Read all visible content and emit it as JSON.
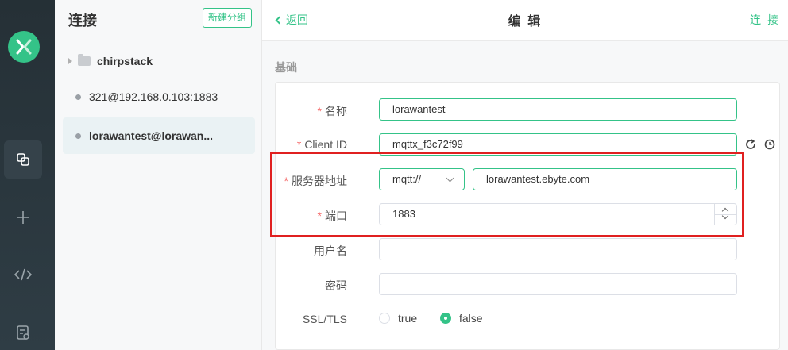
{
  "sidebar_rail": {
    "items": [
      {
        "icon": "connections-icon",
        "active": true
      },
      {
        "icon": "plus-icon",
        "active": false
      },
      {
        "icon": "code-icon",
        "active": false
      },
      {
        "icon": "log-icon",
        "active": false
      }
    ]
  },
  "connections": {
    "title": "连接",
    "new_group_label": "新建分组",
    "folder": "chirpstack",
    "items": [
      {
        "name": "321@192.168.0.103:1883"
      },
      {
        "name": "lorawantest@lorawan..."
      }
    ]
  },
  "header": {
    "back_label": "返回",
    "title": "编 辑",
    "connect_label": "连 接"
  },
  "form": {
    "section": "基础",
    "name": {
      "label": "名称",
      "value": "lorawantest"
    },
    "client_id": {
      "label": "Client ID",
      "value": "mqttx_f3c72f99"
    },
    "host": {
      "label": "服务器地址",
      "protocol": "mqtt://",
      "value": "lorawantest.ebyte.com"
    },
    "port": {
      "label": "端口",
      "value": "1883"
    },
    "username": {
      "label": "用户名",
      "value": ""
    },
    "password": {
      "label": "密码",
      "value": ""
    },
    "ssl": {
      "label": "SSL/TLS",
      "options": [
        "true",
        "false"
      ],
      "selected": "false"
    },
    "required_mark": "*"
  },
  "colors": {
    "accent": "#34c388",
    "highlight": "#e02020",
    "rail": "#2a363d"
  }
}
